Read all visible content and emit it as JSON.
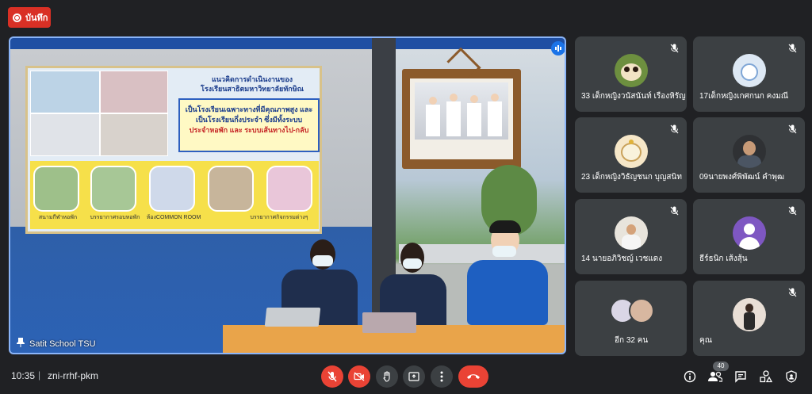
{
  "record": {
    "label": "บันทึก"
  },
  "stage": {
    "presenter_name": "Satit School TSU",
    "slide": {
      "heading_line1": "แนวคิดการดำเนินงานของ",
      "heading_line2": "โรงเรียนสาธิตมหาวิทยาลัยทักษิณ",
      "highlight_line1": "เป็นโรงเรียนเฉพาะทางที่มีคุณภาพสูง และ",
      "highlight_line2": "เป็นโรงเรียนกึ่งประจำ ซึ่งมีทั้งระบบ",
      "highlight_line3": "ประจำหอพัก และ ระบบเส้นทางไป-กลับ",
      "captions": [
        "สนามกีฬาหอพัก",
        "บรรยากาศรอบหอพัก",
        "ห้องCOMMON ROOM",
        "",
        "บรรยากาศกิจกรรมต่างๆ"
      ]
    }
  },
  "participants": [
    {
      "name": "33 เด็กหญิงวนัสนันท์ เรืองหิรัญ",
      "muted": true,
      "avatar": "owl-avatar"
    },
    {
      "name": "17เด็กหญิงเกศกนก คงมณี",
      "muted": true,
      "avatar": "anime-avatar"
    },
    {
      "name": "23 เด็กหญิงวิธัญชนก บุญสนิท",
      "muted": true,
      "avatar": "cat-avatar"
    },
    {
      "name": "09นายพงศ์พิพัฒน์ คำพุฒ",
      "muted": true,
      "avatar": "man-avatar"
    },
    {
      "name": "14 นายอภิวิชญ์ เวชแดง",
      "muted": true,
      "avatar": "photo-avatar"
    },
    {
      "name": "ธีร์ธนิก เส้งสุ้น",
      "muted": true,
      "avatar": "default-avatar",
      "avatar_color": "#7e57c2"
    },
    {
      "name": "อีก 32 คน",
      "muted": false,
      "avatar": "group-avatars"
    },
    {
      "name": "คุณ",
      "muted": true,
      "avatar": "self-avatar"
    }
  ],
  "bottom": {
    "time": "10:35",
    "meeting_code": "zni-rrhf-pkm",
    "people_count": "40"
  },
  "colors": {
    "accent": "#8ab4f8",
    "danger": "#ea4335",
    "tile": "#3c4043",
    "background": "#202124"
  }
}
